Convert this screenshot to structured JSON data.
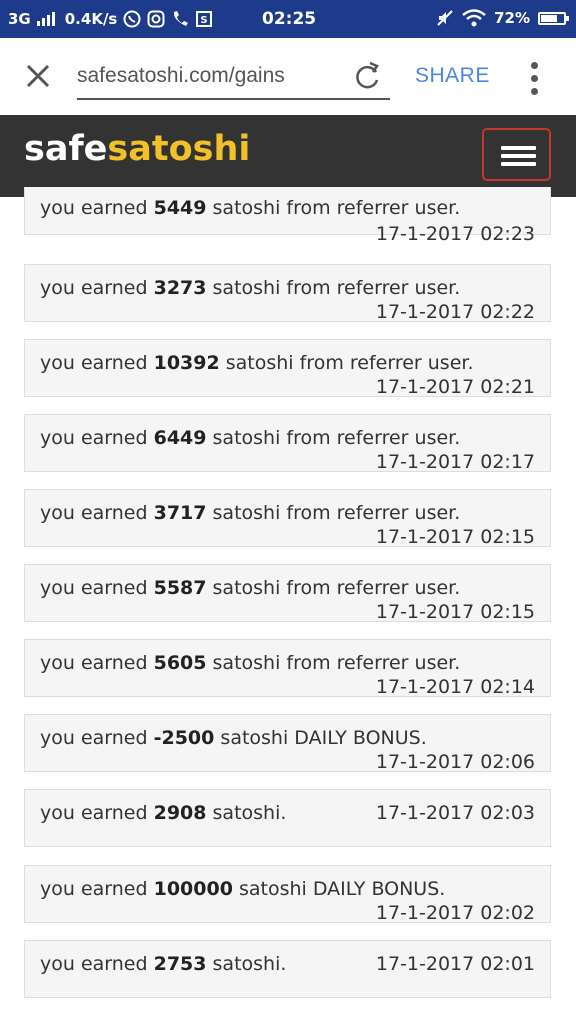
{
  "status_bar": {
    "network": "3G",
    "speed": "0.4K/s",
    "time": "02:25",
    "battery": "72%",
    "battery_level": 0.72
  },
  "browser": {
    "url": "safesatoshi.com/gains",
    "share_label": "SHARE"
  },
  "site": {
    "logo_part1": "safe",
    "logo_part2": "satoshi",
    "accent_color": "#f2c029",
    "nav_color": "#333333"
  },
  "entries": [
    {
      "prefix": "you earned ",
      "amount": "5449",
      "suffix": " satoshi from referrer user.",
      "time": "17-1-2017 02:23"
    },
    {
      "prefix": "you earned ",
      "amount": "3273",
      "suffix": " satoshi from referrer user.",
      "time": "17-1-2017 02:22"
    },
    {
      "prefix": "you earned ",
      "amount": "10392",
      "suffix": " satoshi from referrer user.",
      "time": "17-1-2017 02:21"
    },
    {
      "prefix": "you earned ",
      "amount": "6449",
      "suffix": " satoshi from referrer user.",
      "time": "17-1-2017 02:17"
    },
    {
      "prefix": "you earned ",
      "amount": "3717",
      "suffix": " satoshi from referrer user.",
      "time": "17-1-2017 02:15"
    },
    {
      "prefix": "you earned ",
      "amount": "5587",
      "suffix": " satoshi from referrer user.",
      "time": "17-1-2017 02:15"
    },
    {
      "prefix": "you earned ",
      "amount": "5605",
      "suffix": " satoshi from referrer user.",
      "time": "17-1-2017 02:14"
    },
    {
      "prefix": "you earned ",
      "amount": "-2500",
      "suffix": " satoshi DAILY BONUS.",
      "time": "17-1-2017 02:06"
    },
    {
      "prefix": "you earned ",
      "amount": "2908",
      "suffix": " satoshi.",
      "time": "17-1-2017 02:03"
    },
    {
      "prefix": "you earned ",
      "amount": "100000",
      "suffix": " satoshi DAILY BONUS.",
      "time": "17-1-2017 02:02"
    },
    {
      "prefix": "you earned ",
      "amount": "2753",
      "suffix": " satoshi.",
      "time": "17-1-2017 02:01"
    }
  ]
}
